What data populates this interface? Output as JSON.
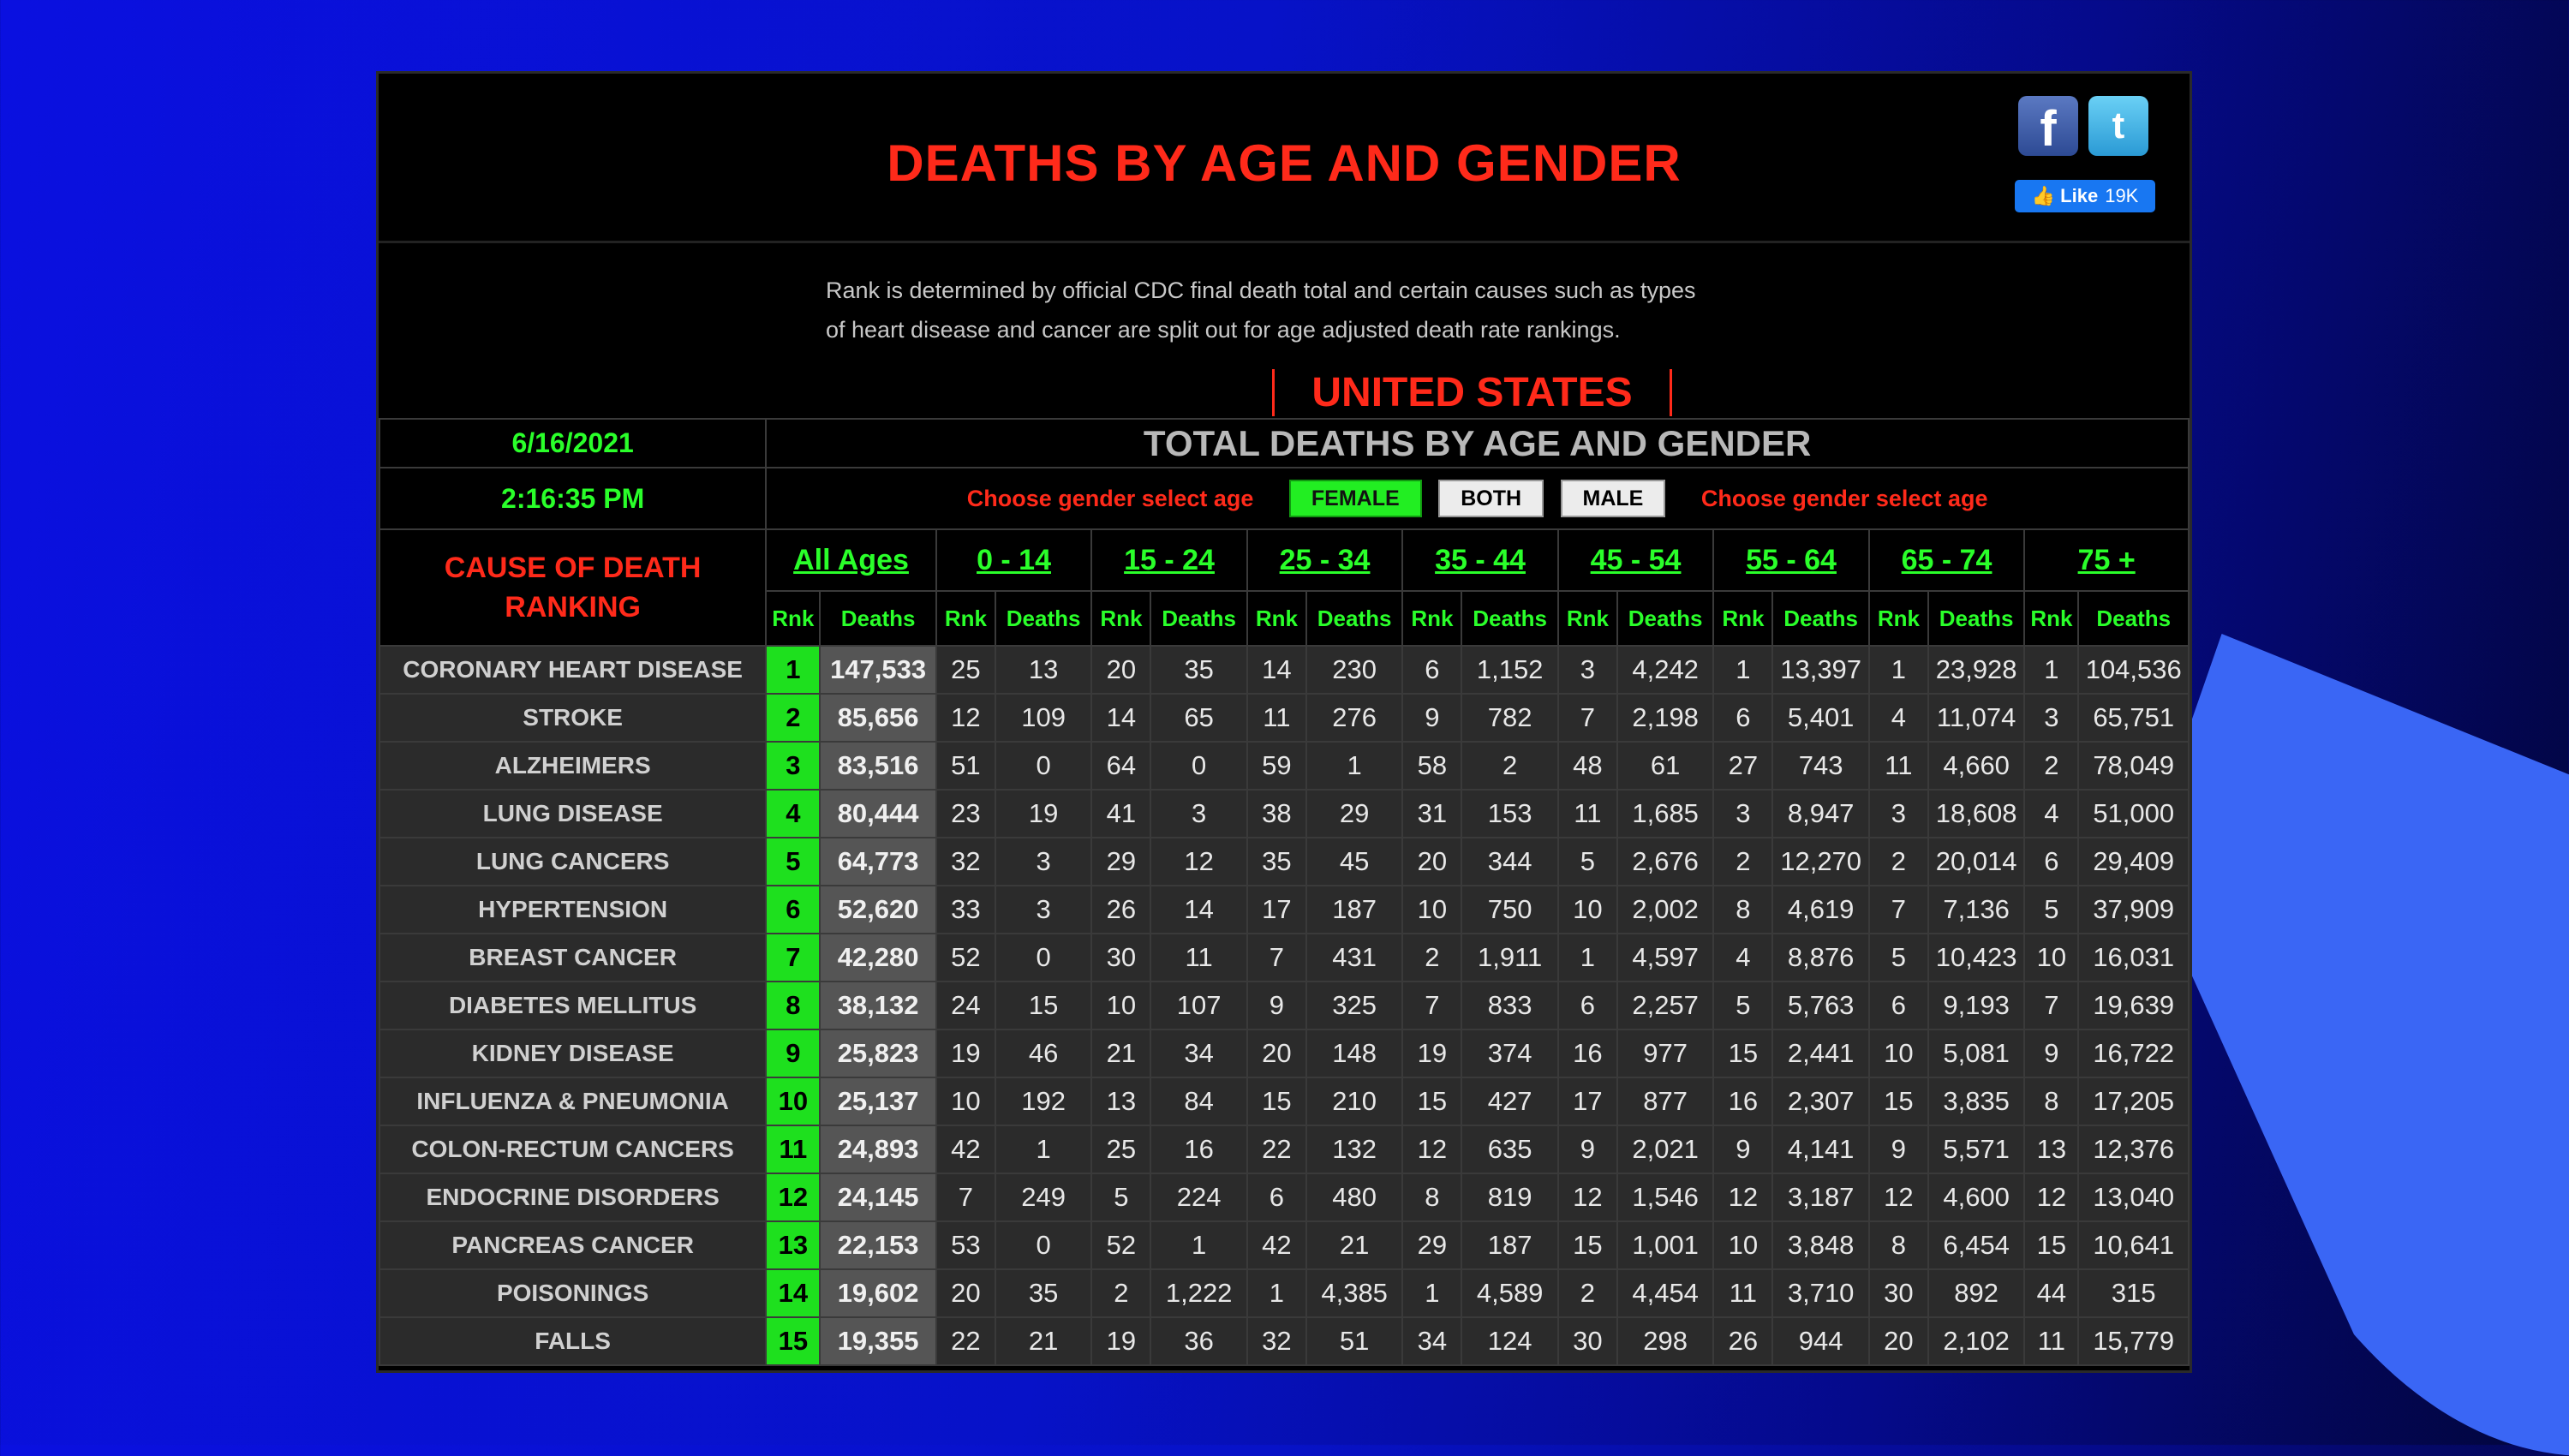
{
  "header": {
    "title": "DEATHS BY AGE AND GENDER"
  },
  "social": {
    "facebook_icon": "f",
    "twitter_icon": "t",
    "like_label": "Like",
    "like_count": "19K"
  },
  "note": {
    "line1": "Rank is determined by official CDC final death total and certain causes such as types",
    "line2": "of heart disease and cancer are split out for age adjusted death rate rankings."
  },
  "country": "UNITED STATES",
  "date": "6/16/2021",
  "time": "2:16:35 PM",
  "table_title": "TOTAL DEATHS BY AGE AND GENDER",
  "gender": {
    "prompt_left": "Choose gender select age",
    "prompt_right": "Choose gender select age",
    "options": [
      "FEMALE",
      "BOTH",
      "MALE"
    ],
    "selected": "FEMALE"
  },
  "cause_header": {
    "line1": "CAUSE OF DEATH",
    "line2": "RANKING"
  },
  "age_groups": [
    "All Ages",
    "0 - 14",
    "15 - 24",
    "25 - 34",
    "35 - 44",
    "45 - 54",
    "55 - 64",
    "65 - 74",
    "75 +"
  ],
  "sub_labels": {
    "rank": "Rnk",
    "deaths": "Deaths"
  },
  "rows": [
    {
      "cause": "CORONARY HEART DISEASE",
      "rank": "1",
      "total": "147,533",
      "ages": [
        [
          "25",
          "13"
        ],
        [
          "20",
          "35"
        ],
        [
          "14",
          "230"
        ],
        [
          "6",
          "1,152"
        ],
        [
          "3",
          "4,242"
        ],
        [
          "1",
          "13,397"
        ],
        [
          "1",
          "23,928"
        ],
        [
          "1",
          "104,536"
        ]
      ]
    },
    {
      "cause": "STROKE",
      "rank": "2",
      "total": "85,656",
      "ages": [
        [
          "12",
          "109"
        ],
        [
          "14",
          "65"
        ],
        [
          "11",
          "276"
        ],
        [
          "9",
          "782"
        ],
        [
          "7",
          "2,198"
        ],
        [
          "6",
          "5,401"
        ],
        [
          "4",
          "11,074"
        ],
        [
          "3",
          "65,751"
        ]
      ]
    },
    {
      "cause": "ALZHEIMERS",
      "rank": "3",
      "total": "83,516",
      "ages": [
        [
          "51",
          "0"
        ],
        [
          "64",
          "0"
        ],
        [
          "59",
          "1"
        ],
        [
          "58",
          "2"
        ],
        [
          "48",
          "61"
        ],
        [
          "27",
          "743"
        ],
        [
          "11",
          "4,660"
        ],
        [
          "2",
          "78,049"
        ]
      ]
    },
    {
      "cause": "LUNG DISEASE",
      "rank": "4",
      "total": "80,444",
      "ages": [
        [
          "23",
          "19"
        ],
        [
          "41",
          "3"
        ],
        [
          "38",
          "29"
        ],
        [
          "31",
          "153"
        ],
        [
          "11",
          "1,685"
        ],
        [
          "3",
          "8,947"
        ],
        [
          "3",
          "18,608"
        ],
        [
          "4",
          "51,000"
        ]
      ]
    },
    {
      "cause": "LUNG CANCERS",
      "rank": "5",
      "total": "64,773",
      "ages": [
        [
          "32",
          "3"
        ],
        [
          "29",
          "12"
        ],
        [
          "35",
          "45"
        ],
        [
          "20",
          "344"
        ],
        [
          "5",
          "2,676"
        ],
        [
          "2",
          "12,270"
        ],
        [
          "2",
          "20,014"
        ],
        [
          "6",
          "29,409"
        ]
      ]
    },
    {
      "cause": "HYPERTENSION",
      "rank": "6",
      "total": "52,620",
      "ages": [
        [
          "33",
          "3"
        ],
        [
          "26",
          "14"
        ],
        [
          "17",
          "187"
        ],
        [
          "10",
          "750"
        ],
        [
          "10",
          "2,002"
        ],
        [
          "8",
          "4,619"
        ],
        [
          "7",
          "7,136"
        ],
        [
          "5",
          "37,909"
        ]
      ]
    },
    {
      "cause": "BREAST CANCER",
      "rank": "7",
      "total": "42,280",
      "ages": [
        [
          "52",
          "0"
        ],
        [
          "30",
          "11"
        ],
        [
          "7",
          "431"
        ],
        [
          "2",
          "1,911"
        ],
        [
          "1",
          "4,597"
        ],
        [
          "4",
          "8,876"
        ],
        [
          "5",
          "10,423"
        ],
        [
          "10",
          "16,031"
        ]
      ]
    },
    {
      "cause": "DIABETES MELLITUS",
      "rank": "8",
      "total": "38,132",
      "ages": [
        [
          "24",
          "15"
        ],
        [
          "10",
          "107"
        ],
        [
          "9",
          "325"
        ],
        [
          "7",
          "833"
        ],
        [
          "6",
          "2,257"
        ],
        [
          "5",
          "5,763"
        ],
        [
          "6",
          "9,193"
        ],
        [
          "7",
          "19,639"
        ]
      ]
    },
    {
      "cause": "KIDNEY DISEASE",
      "rank": "9",
      "total": "25,823",
      "ages": [
        [
          "19",
          "46"
        ],
        [
          "21",
          "34"
        ],
        [
          "20",
          "148"
        ],
        [
          "19",
          "374"
        ],
        [
          "16",
          "977"
        ],
        [
          "15",
          "2,441"
        ],
        [
          "10",
          "5,081"
        ],
        [
          "9",
          "16,722"
        ]
      ]
    },
    {
      "cause": "INFLUENZA & PNEUMONIA",
      "rank": "10",
      "total": "25,137",
      "ages": [
        [
          "10",
          "192"
        ],
        [
          "13",
          "84"
        ],
        [
          "15",
          "210"
        ],
        [
          "15",
          "427"
        ],
        [
          "17",
          "877"
        ],
        [
          "16",
          "2,307"
        ],
        [
          "15",
          "3,835"
        ],
        [
          "8",
          "17,205"
        ]
      ]
    },
    {
      "cause": "COLON-RECTUM CANCERS",
      "rank": "11",
      "total": "24,893",
      "ages": [
        [
          "42",
          "1"
        ],
        [
          "25",
          "16"
        ],
        [
          "22",
          "132"
        ],
        [
          "12",
          "635"
        ],
        [
          "9",
          "2,021"
        ],
        [
          "9",
          "4,141"
        ],
        [
          "9",
          "5,571"
        ],
        [
          "13",
          "12,376"
        ]
      ]
    },
    {
      "cause": "ENDOCRINE DISORDERS",
      "rank": "12",
      "total": "24,145",
      "ages": [
        [
          "7",
          "249"
        ],
        [
          "5",
          "224"
        ],
        [
          "6",
          "480"
        ],
        [
          "8",
          "819"
        ],
        [
          "12",
          "1,546"
        ],
        [
          "12",
          "3,187"
        ],
        [
          "12",
          "4,600"
        ],
        [
          "12",
          "13,040"
        ]
      ]
    },
    {
      "cause": "PANCREAS CANCER",
      "rank": "13",
      "total": "22,153",
      "ages": [
        [
          "53",
          "0"
        ],
        [
          "52",
          "1"
        ],
        [
          "42",
          "21"
        ],
        [
          "29",
          "187"
        ],
        [
          "15",
          "1,001"
        ],
        [
          "10",
          "3,848"
        ],
        [
          "8",
          "6,454"
        ],
        [
          "15",
          "10,641"
        ]
      ]
    },
    {
      "cause": "POISONINGS",
      "rank": "14",
      "total": "19,602",
      "ages": [
        [
          "20",
          "35"
        ],
        [
          "2",
          "1,222"
        ],
        [
          "1",
          "4,385"
        ],
        [
          "1",
          "4,589"
        ],
        [
          "2",
          "4,454"
        ],
        [
          "11",
          "3,710"
        ],
        [
          "30",
          "892"
        ],
        [
          "44",
          "315"
        ]
      ]
    },
    {
      "cause": "FALLS",
      "rank": "15",
      "total": "19,355",
      "ages": [
        [
          "22",
          "21"
        ],
        [
          "19",
          "36"
        ],
        [
          "32",
          "51"
        ],
        [
          "34",
          "124"
        ],
        [
          "30",
          "298"
        ],
        [
          "26",
          "944"
        ],
        [
          "20",
          "2,102"
        ],
        [
          "11",
          "15,779"
        ]
      ]
    }
  ]
}
